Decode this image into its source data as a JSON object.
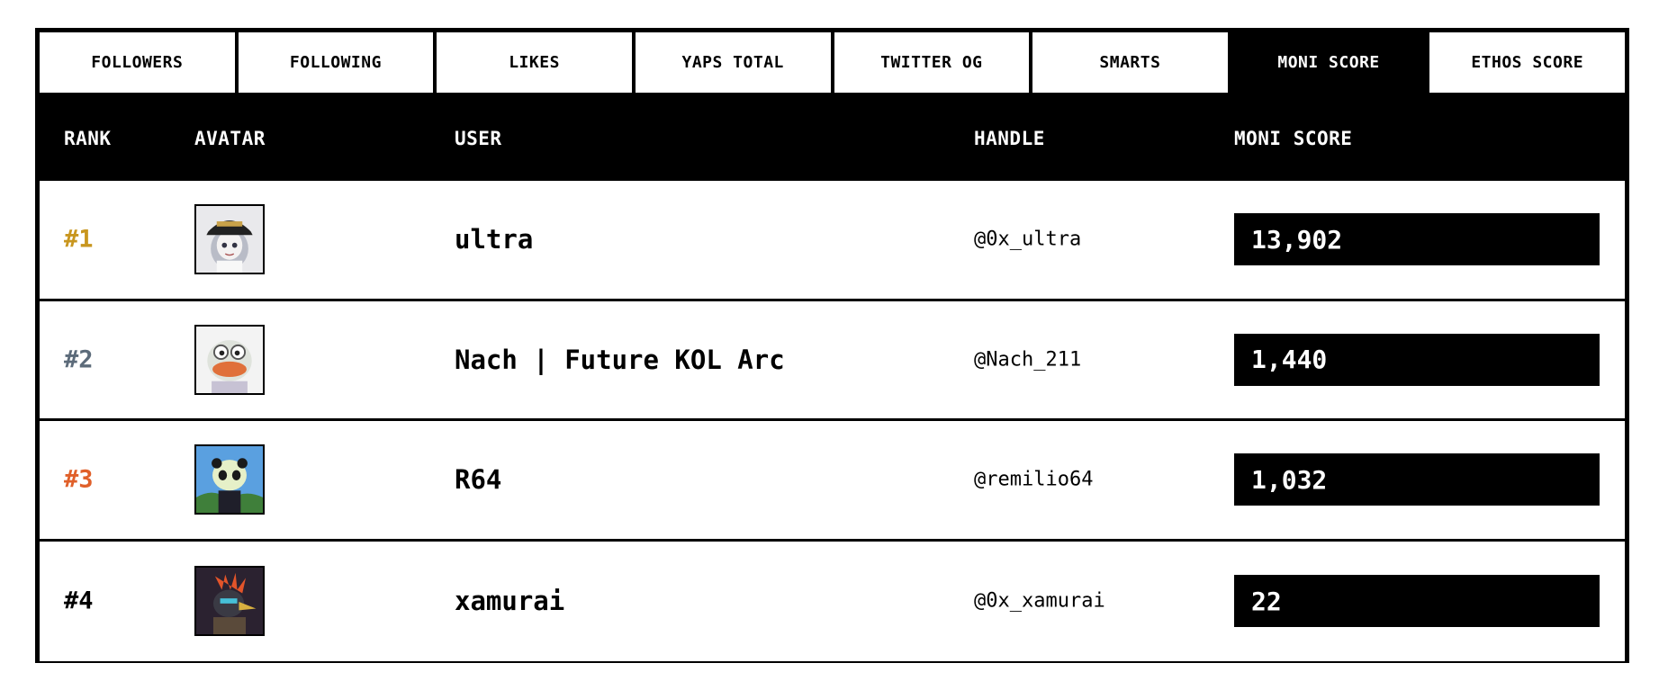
{
  "tabs": [
    {
      "label": "FOLLOWERS",
      "active": false
    },
    {
      "label": "FOLLOWING",
      "active": false
    },
    {
      "label": "LIKES",
      "active": false
    },
    {
      "label": "YAPS TOTAL",
      "active": false
    },
    {
      "label": "TWITTER OG",
      "active": false
    },
    {
      "label": "SMARTS",
      "active": false
    },
    {
      "label": "MONI SCORE",
      "active": true
    },
    {
      "label": "ETHOS SCORE",
      "active": false
    }
  ],
  "table": {
    "headers": {
      "rank": "RANK",
      "avatar": "AVATAR",
      "user": "USER",
      "handle": "HANDLE",
      "score": "MONI SCORE"
    },
    "rows": [
      {
        "rank": "#1",
        "rank_color": "#c8961f",
        "avatar_icon": "avatar-cap-anime-icon",
        "user": "ultra",
        "handle": "@0x_ultra",
        "score": "13,902"
      },
      {
        "rank": "#2",
        "rank_color": "#5c6b7a",
        "avatar_icon": "avatar-pepe-icon",
        "user": "Nach | Future KOL Arc",
        "handle": "@Nach_211",
        "score": "1,440"
      },
      {
        "rank": "#3",
        "rank_color": "#e0602a",
        "avatar_icon": "avatar-panda-icon",
        "user": "R64",
        "handle": "@remilio64",
        "score": "1,032"
      },
      {
        "rank": "#4",
        "rank_color": "#000000",
        "avatar_icon": "avatar-crow-icon",
        "user": "xamurai",
        "handle": "@0x_xamurai",
        "score": "22"
      }
    ]
  }
}
